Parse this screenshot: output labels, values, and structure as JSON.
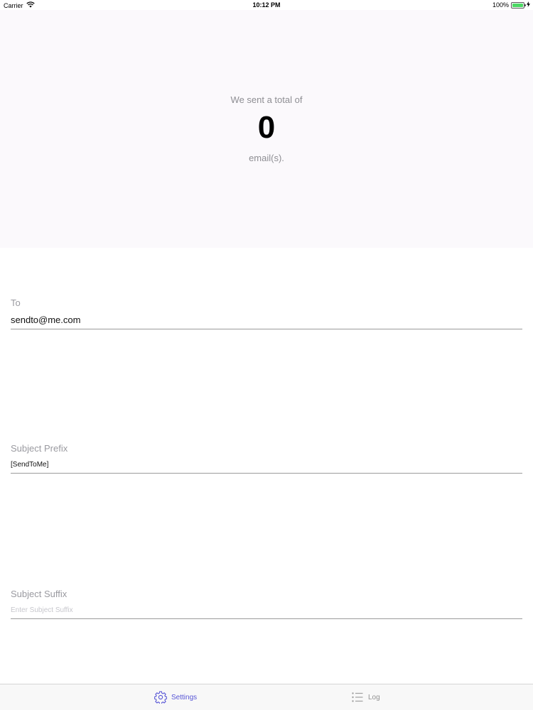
{
  "status_bar": {
    "carrier": "Carrier",
    "time": "10:12 PM",
    "battery_percent": "100%",
    "battery_level": 1.0,
    "icons": [
      "wifi-icon",
      "battery-icon",
      "charging-bolt-icon"
    ]
  },
  "summary": {
    "line1": "We sent a total of",
    "count": "0",
    "line2": "email(s)."
  },
  "form": {
    "to": {
      "label": "To",
      "value": "sendto@me.com",
      "placeholder": ""
    },
    "subject_prefix": {
      "label": "Subject Prefix",
      "value": "[SendToMe]",
      "placeholder": ""
    },
    "subject_suffix": {
      "label": "Subject Suffix",
      "value": "",
      "placeholder": "Enter Subject Suffix"
    }
  },
  "tab_bar": {
    "tabs": [
      {
        "label": "Settings",
        "icon": "gear-icon",
        "selected": true
      },
      {
        "label": "Log",
        "icon": "list-icon",
        "selected": false
      }
    ]
  },
  "colors": {
    "accent": "#5856d6",
    "summary_background": "#fbf9fc",
    "secondary_text": "#8e8e93",
    "battery": "#4cd964"
  }
}
